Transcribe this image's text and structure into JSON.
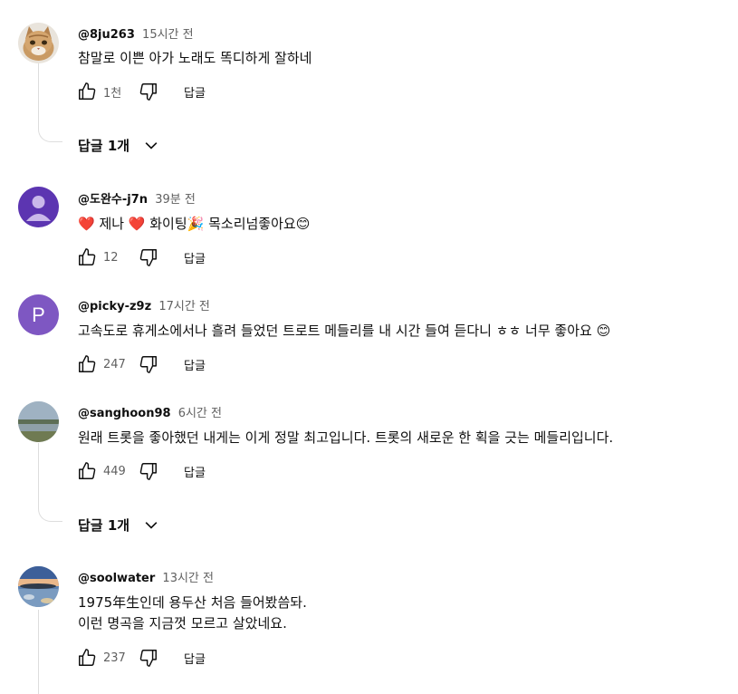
{
  "comments": [
    {
      "author": "@8ju263",
      "time": "15시간 전",
      "text_lines": [
        "참말로 이쁜 아가 노래도 똑디하게 잘하네"
      ],
      "likes": "1천",
      "reply_label": "답글",
      "replies_toggle": "답글 1개",
      "avatar": "cat-photo"
    },
    {
      "author": "@도완수-j7n",
      "time": "39분 전",
      "text_lines": [
        "❤️ 제나 ❤️ 화이팅🎉 목소리넘좋아요😊"
      ],
      "likes": "12",
      "reply_label": "답글",
      "avatar": "default-user-purple"
    },
    {
      "author": "@picky-z9z",
      "time": "17시간 전",
      "text_lines": [
        "고속도로 휴게소에서나 흘려 들었던 트로트 메들리를 내 시간 들여 듣다니 ㅎㅎ 너무 좋아요 😊"
      ],
      "likes": "247",
      "reply_label": "답글",
      "avatar_letter": "P",
      "avatar_color": "#7e57c2"
    },
    {
      "author": "@sanghoon98",
      "time": "6시간 전",
      "text_lines": [
        "원래 트롯을 좋아했던 내게는 이게 정말 최고입니다. 트롯의 새로운 한 획을 긋는 메들리입니다."
      ],
      "likes": "449",
      "reply_label": "답글",
      "replies_toggle": "답글 1개",
      "avatar": "landscape-photo"
    },
    {
      "author": "@soolwater",
      "time": "13시간 전",
      "text_lines": [
        "1975年生인데 용두산 처음 들어봤씀돠.",
        "이런 명곡을 지금껏 모르고 살았네요."
      ],
      "likes": "237",
      "reply_label": "답글",
      "avatar": "sunset-photo"
    }
  ]
}
